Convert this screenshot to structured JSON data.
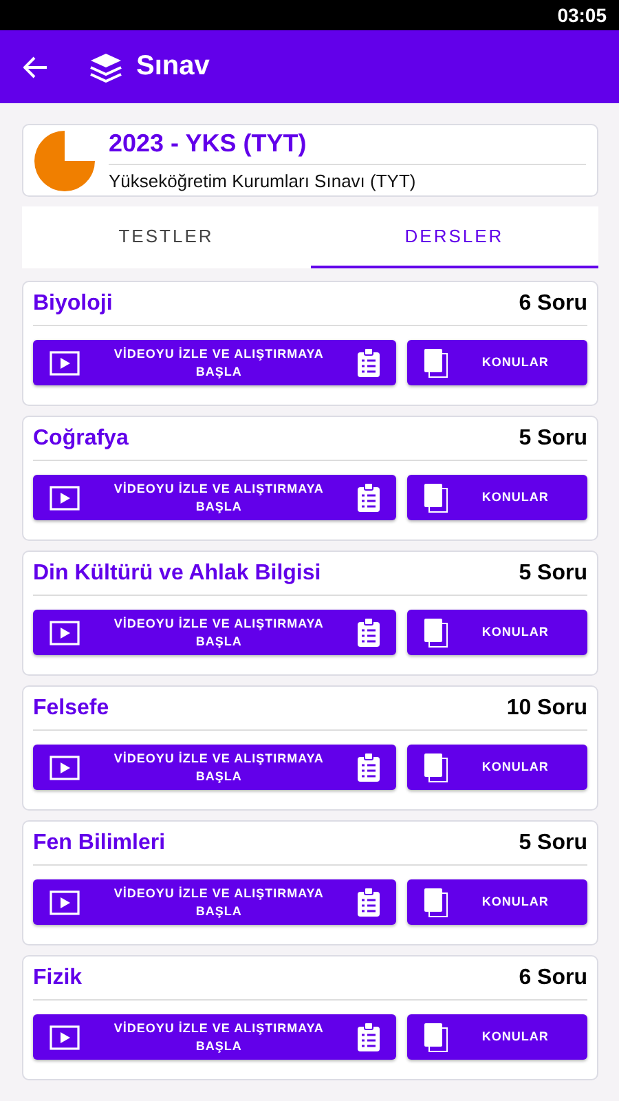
{
  "status_bar": {
    "time": "03:05"
  },
  "app_bar": {
    "title": "Sınav"
  },
  "exam": {
    "title": "2023 - YKS (TYT)",
    "subtitle": "Yükseköğretim Kurumları Sınavı (TYT)"
  },
  "tabs": [
    {
      "label": "TESTLER",
      "selected": false
    },
    {
      "label": "DERSLER",
      "selected": true
    }
  ],
  "subjects": [
    {
      "name": "Biyoloji",
      "count": "6 Soru",
      "video_button": "VİDEOYU İZLE VE ALIŞTIRMAYA BAŞLA",
      "topics_button": "KONULAR"
    },
    {
      "name": "Coğrafya",
      "count": "5 Soru",
      "video_button": "VİDEOYU İZLE VE ALIŞTIRMAYA BAŞLA",
      "topics_button": "KONULAR"
    },
    {
      "name": "Din Kültürü ve Ahlak Bilgisi",
      "count": "5 Soru",
      "video_button": "VİDEOYU İZLE VE ALIŞTIRMAYA BAŞLA",
      "topics_button": "KONULAR"
    },
    {
      "name": "Felsefe",
      "count": "10 Soru",
      "video_button": "VİDEOYU İZLE VE ALIŞTIRMAYA BAŞLA",
      "topics_button": "KONULAR"
    },
    {
      "name": "Fen Bilimleri",
      "count": "5 Soru",
      "video_button": "VİDEOYU İZLE VE ALIŞTIRMAYA BAŞLA",
      "topics_button": "KONULAR"
    },
    {
      "name": "Fizik",
      "count": "6 Soru",
      "video_button": "VİDEOYU İZLE VE ALIŞTIRMAYA BAŞLA",
      "topics_button": "KONULAR"
    }
  ]
}
